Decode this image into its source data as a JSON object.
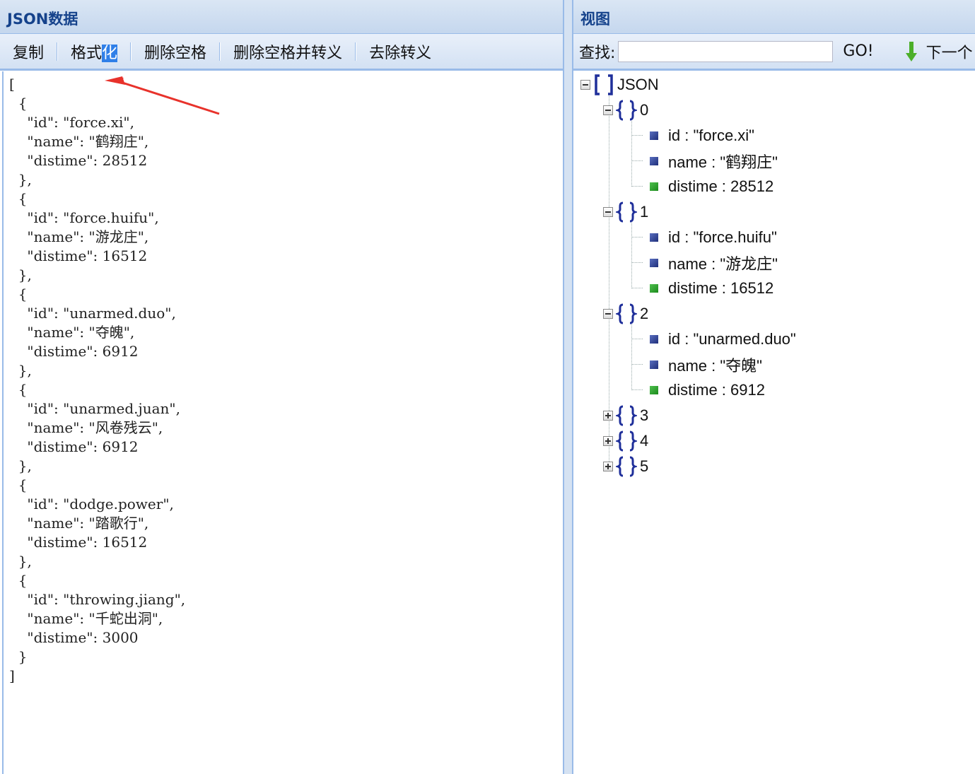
{
  "left_panel": {
    "title": "JSON数据",
    "toolbar": {
      "copy": "复制",
      "format_prefix": "格式",
      "format_selected": "化",
      "remove_spaces": "删除空格",
      "remove_spaces_escape": "删除空格并转义",
      "remove_escape": "去除转义"
    },
    "editor_text": "[\n  {\n    \"id\": \"force.xi\",\n    \"name\": \"鹤翔庄\",\n    \"distime\": 28512\n  },\n  {\n    \"id\": \"force.huifu\",\n    \"name\": \"游龙庄\",\n    \"distime\": 16512\n  },\n  {\n    \"id\": \"unarmed.duo\",\n    \"name\": \"夺魄\",\n    \"distime\": 6912\n  },\n  {\n    \"id\": \"unarmed.juan\",\n    \"name\": \"风卷残云\",\n    \"distime\": 6912\n  },\n  {\n    \"id\": \"dodge.power\",\n    \"name\": \"踏歌行\",\n    \"distime\": 16512\n  },\n  {\n    \"id\": \"throwing.jiang\",\n    \"name\": \"千蛇出洞\",\n    \"distime\": 3000\n  }\n]"
  },
  "right_panel": {
    "title": "视图",
    "search": {
      "label": "查找:",
      "value": "",
      "go": "GO!",
      "next": "下一个"
    },
    "tree": {
      "root": "JSON",
      "nodes": [
        {
          "key": "0",
          "children": [
            "id : \"force.xi\"",
            "name : \"鹤翔庄\"",
            "distime : 28512"
          ]
        },
        {
          "key": "1",
          "children": [
            "id : \"force.huifu\"",
            "name : \"游龙庄\"",
            "distime : 16512"
          ]
        },
        {
          "key": "2",
          "children": [
            "id : \"unarmed.duo\"",
            "name : \"夺魄\"",
            "distime : 6912"
          ]
        },
        {
          "key": "3"
        },
        {
          "key": "4"
        },
        {
          "key": "5"
        }
      ]
    }
  },
  "colors": {
    "header_text": "#15428b",
    "border": "#99bbe8",
    "string_icon": "#1f2f7a",
    "number_icon": "#1c8a1c",
    "brace_icon": "#1f2f9a",
    "annotation_arrow": "#e8322b",
    "selection": "#2f7fe8"
  }
}
